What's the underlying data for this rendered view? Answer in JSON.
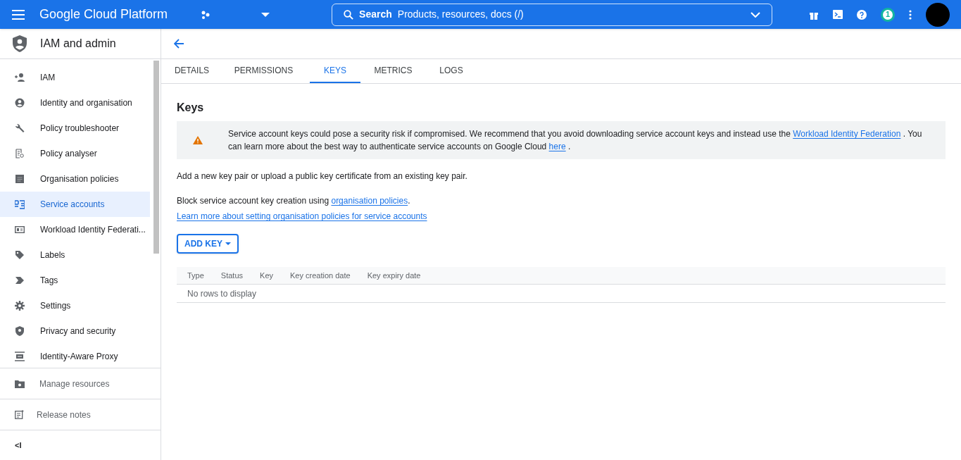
{
  "header": {
    "product": "Google Cloud Platform",
    "search": {
      "label": "Search",
      "placeholder": "Products, resources, docs (/)"
    },
    "notification_count": "1"
  },
  "sidebar": {
    "title": "IAM and admin",
    "items": [
      {
        "label": "IAM",
        "selected": false
      },
      {
        "label": "Identity and organisation",
        "selected": false
      },
      {
        "label": "Policy troubleshooter",
        "selected": false
      },
      {
        "label": "Policy analyser",
        "selected": false
      },
      {
        "label": "Organisation policies",
        "selected": false
      },
      {
        "label": "Service accounts",
        "selected": true
      },
      {
        "label": "Workload Identity Federati...",
        "selected": false
      },
      {
        "label": "Labels",
        "selected": false
      },
      {
        "label": "Tags",
        "selected": false
      },
      {
        "label": "Settings",
        "selected": false
      },
      {
        "label": "Privacy and security",
        "selected": false
      },
      {
        "label": "Identity-Aware Proxy",
        "selected": false
      }
    ],
    "manage_resources": "Manage resources",
    "release_notes": "Release notes",
    "collapse": "<I"
  },
  "tabs": [
    {
      "label": "DETAILS",
      "selected": false
    },
    {
      "label": "PERMISSIONS",
      "selected": false
    },
    {
      "label": "KEYS",
      "selected": true
    },
    {
      "label": "METRICS",
      "selected": false
    },
    {
      "label": "LOGS",
      "selected": false
    }
  ],
  "heading": "Keys",
  "warning": [
    {
      "kind": "text",
      "text": "Service account keys could pose a security risk if compromised. We recommend that you avoid downloading service account keys and instead use the "
    },
    {
      "kind": "link",
      "text": "Workload Identity Federation"
    },
    {
      "kind": "text",
      "text": " . You can learn more about the best way to authenticate service accounts on Google Cloud "
    },
    {
      "kind": "link",
      "text": "here"
    },
    {
      "kind": "text",
      "text": " ."
    }
  ],
  "intro": "Add a new key pair or upload a public key certificate from an existing key pair.",
  "block_text": "Block service account key creation using ",
  "block_link": "organisation policies",
  "block_end": ".",
  "learn_link": "Learn more about setting organisation policies for service accounts",
  "add_key": "ADD KEY",
  "table": {
    "columns": [
      "Type",
      "Status",
      "Key",
      "Key creation date",
      "Key expiry date"
    ],
    "empty": "No rows to display"
  }
}
